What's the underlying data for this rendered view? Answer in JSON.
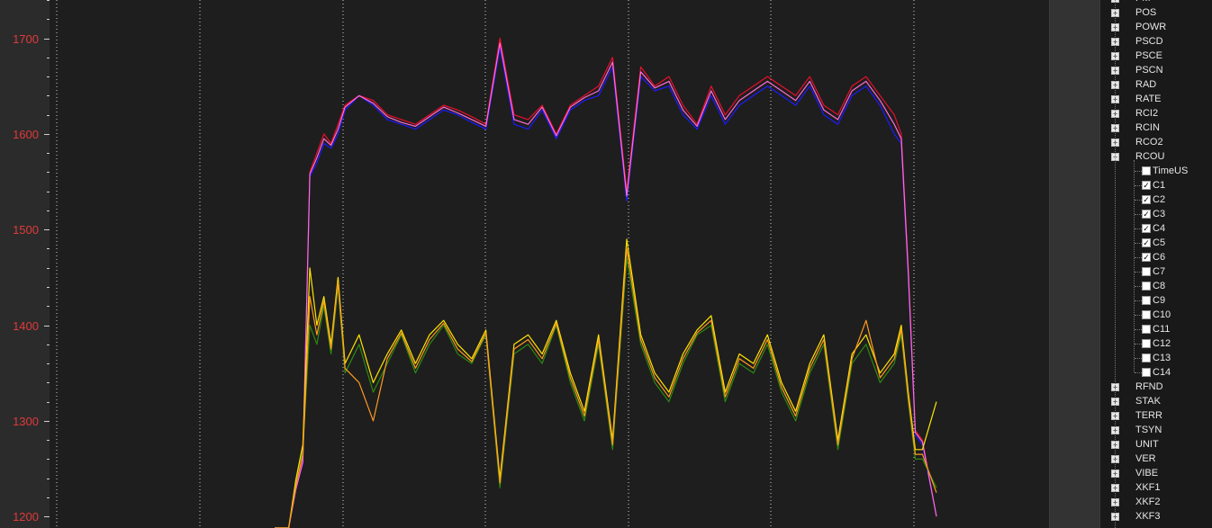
{
  "colors": {
    "background": "#1e1e1e",
    "axis_label": "#e03a3a",
    "tree_text": "#e6e6e6",
    "series": [
      "#e8102a",
      "#1c1cff",
      "#ff6cd6",
      "#2a8a10",
      "#ffe400",
      "#ff9a1e"
    ]
  },
  "chart_data": {
    "type": "line",
    "title": "",
    "xlabel": "",
    "ylabel": "",
    "ylim": [
      1188,
      1740
    ],
    "yticks": [
      "1700",
      "1600",
      "1500",
      "1400",
      "1300",
      "1200"
    ],
    "grid": "vertical-dotted",
    "legend": "none",
    "x": [
      0,
      2,
      3,
      4,
      5,
      6,
      7,
      8,
      9,
      10,
      12,
      14,
      16,
      18,
      20,
      22,
      24,
      26,
      28,
      30,
      32,
      34,
      36,
      38,
      40,
      42,
      44,
      46,
      48,
      50,
      52,
      54,
      56,
      58,
      60,
      62,
      64,
      66,
      68,
      70,
      72,
      74,
      76,
      78,
      80,
      82,
      84,
      86,
      88,
      89,
      90,
      91,
      92,
      94
    ],
    "series": [
      {
        "values": [
          1188,
          1188,
          1230,
          1260,
          1560,
          1580,
          1600,
          1590,
          1610,
          1630,
          1640,
          1635,
          1620,
          1615,
          1610,
          1620,
          1630,
          1625,
          1618,
          1610,
          1700,
          1620,
          1615,
          1630,
          1600,
          1630,
          1640,
          1650,
          1680,
          1540,
          1670,
          1650,
          1660,
          1630,
          1610,
          1650,
          1620,
          1640,
          1650,
          1660,
          1650,
          1640,
          1660,
          1630,
          1620,
          1650,
          1660,
          1640,
          1620,
          1600,
          1460,
          1290,
          1280,
          1200
        ]
      },
      {
        "values": [
          1188,
          1188,
          1230,
          1255,
          1555,
          1570,
          1590,
          1585,
          1600,
          1625,
          1640,
          1630,
          1615,
          1610,
          1605,
          1615,
          1625,
          1620,
          1612,
          1605,
          1690,
          1610,
          1605,
          1625,
          1595,
          1625,
          1635,
          1640,
          1670,
          1530,
          1660,
          1645,
          1650,
          1620,
          1605,
          1640,
          1610,
          1630,
          1640,
          1650,
          1640,
          1630,
          1650,
          1620,
          1610,
          1640,
          1650,
          1630,
          1600,
          1590,
          1450,
          1285,
          1275,
          1200
        ]
      },
      {
        "values": [
          1188,
          1188,
          1228,
          1257,
          1558,
          1575,
          1595,
          1588,
          1605,
          1628,
          1640,
          1632,
          1618,
          1612,
          1608,
          1618,
          1628,
          1622,
          1615,
          1608,
          1695,
          1615,
          1610,
          1628,
          1598,
          1628,
          1638,
          1645,
          1675,
          1535,
          1665,
          1648,
          1655,
          1625,
          1608,
          1645,
          1615,
          1635,
          1645,
          1655,
          1645,
          1635,
          1655,
          1625,
          1615,
          1645,
          1655,
          1635,
          1610,
          1595,
          1455,
          1288,
          1278,
          1200
        ]
      },
      {
        "values": [
          1188,
          1188,
          1235,
          1270,
          1400,
          1380,
          1420,
          1370,
          1440,
          1350,
          1380,
          1330,
          1360,
          1390,
          1350,
          1380,
          1400,
          1370,
          1360,
          1390,
          1230,
          1370,
          1380,
          1360,
          1400,
          1340,
          1300,
          1380,
          1270,
          1470,
          1380,
          1340,
          1320,
          1360,
          1390,
          1400,
          1320,
          1360,
          1350,
          1380,
          1330,
          1300,
          1350,
          1380,
          1270,
          1360,
          1380,
          1340,
          1360,
          1390,
          1320,
          1260,
          1260,
          1230
        ]
      },
      {
        "values": [
          1188,
          1188,
          1238,
          1275,
          1460,
          1400,
          1430,
          1380,
          1450,
          1360,
          1390,
          1340,
          1370,
          1395,
          1360,
          1390,
          1405,
          1380,
          1365,
          1395,
          1240,
          1380,
          1390,
          1370,
          1405,
          1350,
          1310,
          1390,
          1280,
          1490,
          1390,
          1350,
          1330,
          1370,
          1395,
          1410,
          1330,
          1370,
          1360,
          1390,
          1340,
          1310,
          1360,
          1390,
          1280,
          1370,
          1390,
          1350,
          1370,
          1400,
          1330,
          1270,
          1270,
          1320
        ]
      },
      {
        "values": [
          1188,
          1188,
          1232,
          1265,
          1430,
          1390,
          1425,
          1375,
          1445,
          1355,
          1340,
          1300,
          1365,
          1392,
          1355,
          1385,
          1402,
          1375,
          1362,
          1392,
          1235,
          1375,
          1385,
          1365,
          1402,
          1345,
          1305,
          1385,
          1275,
          1480,
          1385,
          1345,
          1325,
          1365,
          1392,
          1405,
          1325,
          1365,
          1355,
          1385,
          1335,
          1305,
          1355,
          1385,
          1275,
          1365,
          1405,
          1345,
          1365,
          1395,
          1325,
          1265,
          1265,
          1225
        ]
      }
    ]
  },
  "tree": {
    "top_items": [
      "PM",
      "POS",
      "POWR",
      "PSCD",
      "PSCE",
      "PSCN",
      "RAD",
      "RATE",
      "RCI2",
      "RCIN",
      "RCO2"
    ],
    "expanded": "RCOU",
    "children": [
      {
        "label": "TimeUS",
        "checked": false
      },
      {
        "label": "C1",
        "checked": true
      },
      {
        "label": "C2",
        "checked": true
      },
      {
        "label": "C3",
        "checked": true
      },
      {
        "label": "C4",
        "checked": true
      },
      {
        "label": "C5",
        "checked": true
      },
      {
        "label": "C6",
        "checked": true
      },
      {
        "label": "C7",
        "checked": false
      },
      {
        "label": "C8",
        "checked": false
      },
      {
        "label": "C9",
        "checked": false
      },
      {
        "label": "C10",
        "checked": false
      },
      {
        "label": "C11",
        "checked": false
      },
      {
        "label": "C12",
        "checked": false
      },
      {
        "label": "C13",
        "checked": false
      },
      {
        "label": "C14",
        "checked": false
      }
    ],
    "bottom_items": [
      "RFND",
      "STAK",
      "TERR",
      "TSYN",
      "UNIT",
      "VER",
      "VIBE",
      "XKF1",
      "XKF2",
      "XKF3"
    ],
    "plus": "+",
    "minus": "−",
    "check": "✓"
  }
}
